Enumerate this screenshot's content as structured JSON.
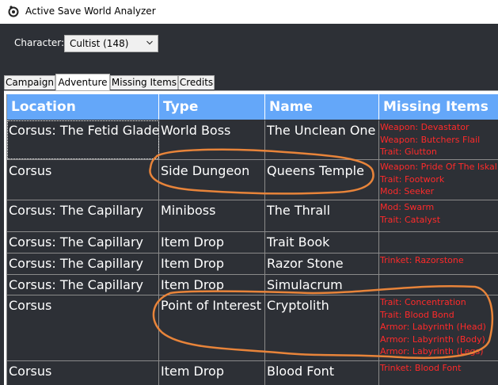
{
  "window": {
    "title": "Active Save World Analyzer"
  },
  "character": {
    "label": "Character:",
    "selected": "Cultist (148)"
  },
  "tabs": [
    {
      "label": "Campaign",
      "active": false
    },
    {
      "label": "Adventure",
      "active": true
    },
    {
      "label": "Missing Items",
      "active": false
    },
    {
      "label": "Credits",
      "active": false
    }
  ],
  "table": {
    "columns": [
      "Location",
      "Type",
      "Name",
      "Missing Items"
    ],
    "rows": [
      {
        "location": "Corsus: The Fetid Glade",
        "type": "World Boss",
        "name": "The Unclean One",
        "missing": [
          "Weapon: Devastator",
          "Weapon: Butchers Flail",
          "Trait: Glutton"
        ]
      },
      {
        "location": "Corsus",
        "type": "Side Dungeon",
        "name": "Queens Temple",
        "missing": [
          "Weapon: Pride Of The Iskal",
          "Trait: Footwork",
          "Mod: Seeker"
        ]
      },
      {
        "location": "Corsus: The Capillary",
        "type": "Miniboss",
        "name": "The Thrall",
        "missing": [
          "Mod: Swarm",
          "Trait: Catalyst"
        ]
      },
      {
        "location": "Corsus: The Capillary",
        "type": "Item Drop",
        "name": "Trait Book",
        "missing": []
      },
      {
        "location": "Corsus: The Capillary",
        "type": "Item Drop",
        "name": "Razor Stone",
        "missing": [
          "Trinket: Razorstone"
        ]
      },
      {
        "location": "Corsus: The Capillary",
        "type": "Item Drop",
        "name": "Simulacrum",
        "missing": []
      },
      {
        "location": "Corsus",
        "type": "Point of Interest",
        "name": "Cryptolith",
        "missing": [
          "Trait: Concentration",
          "Trait: Blood Bond",
          "Armor: Labyrinth (Head)",
          "Armor: Labyrinth (Body)",
          "Armor: Labyrinth (Legs)"
        ]
      },
      {
        "location": "Corsus",
        "type": "Item Drop",
        "name": "Blood Font",
        "missing": [
          "Trinket: Blood Font"
        ]
      }
    ]
  },
  "colors": {
    "header_bg": "#64a7f9",
    "grid_bg": "#2d3036",
    "missing_text": "#ff2a2a",
    "annotation": "#e8843a"
  },
  "icons": {
    "app": "app-logo-icon",
    "dropdown": "chevron-down-icon"
  }
}
